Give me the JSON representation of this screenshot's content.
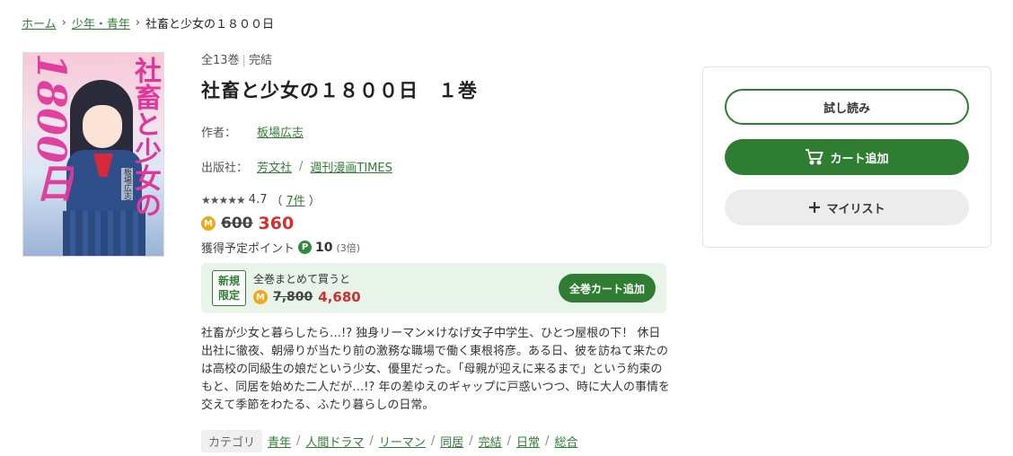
{
  "breadcrumb": {
    "home": "ホーム",
    "category": "少年・青年",
    "current": "社畜と少女の１８００日"
  },
  "book": {
    "volumes": "全13巻",
    "status": "完結",
    "title": "社畜と少女の１８００日　１巻",
    "author_label": "作者：",
    "author": "板場広志",
    "publisher_label": "出版社：",
    "publisher": "芳文社",
    "magazine": "週刊漫画TIMES",
    "rating_value": "4.7",
    "review_count": "7件",
    "rating_stars": 4.7,
    "price_old": "600",
    "price_new": "360",
    "points_label": "獲得予定ポイント",
    "points": "10",
    "points_mult": "(3倍)"
  },
  "cover": {
    "title_vertical": "社畜と少女の",
    "title_number": "1800日",
    "author": "板場広志"
  },
  "bundle": {
    "badge_line1": "新規",
    "badge_line2": "限定",
    "caption": "全巻まとめて買うと",
    "price_old": "7,800",
    "price_new": "4,680",
    "button": "全巻カート追加"
  },
  "description": "社畜が少女と暮らしたら…!? 独身リーマン×けなげ女子中学生、ひとつ屋根の下！ 休日出社に徹夜、朝帰りが当たり前の激務な職場で働く東根将彦。ある日、彼を訪ねて来たのは高校の同級生の娘だという少女、優里だった。「母親が迎えに来るまで」という約束のもと、同居を始めた二人だが…!? 年の差ゆえのギャップに戸惑いつつ、時に大人の事情を交えて季節をわたる、ふたり暮らしの日常。",
  "tags": {
    "label": "カテゴリ",
    "items": [
      "青年",
      "人間ドラマ",
      "リーマン",
      "同居",
      "完結",
      "日常",
      "総合"
    ]
  },
  "actions": {
    "trial": "試し読み",
    "cart": "カート追加",
    "mylist": "マイリスト"
  },
  "icons": {
    "coin": "coin-icon",
    "point": "point-icon",
    "cart": "cart-icon",
    "plus": "plus-icon",
    "star": "star-icon"
  },
  "colors": {
    "accent": "#2e7d32",
    "price": "#d32f2f",
    "coin": "#f0a818"
  }
}
